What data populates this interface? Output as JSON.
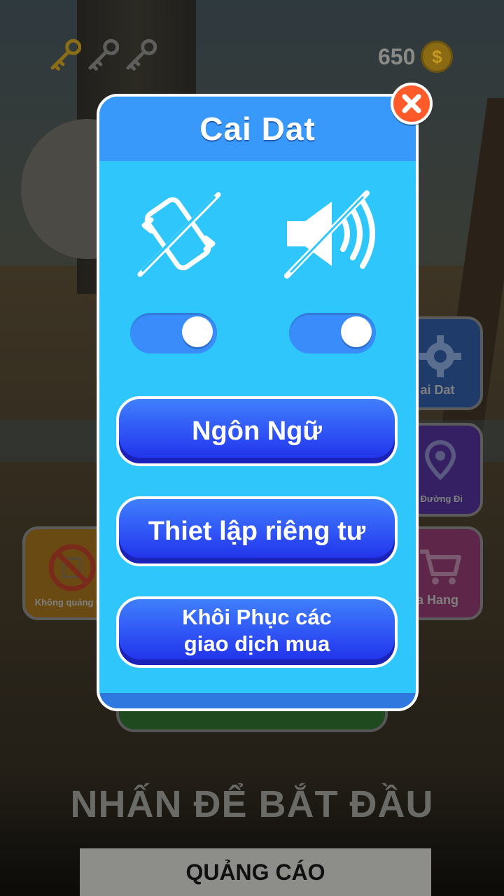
{
  "hud": {
    "keys": {
      "total": 3,
      "collected": 1,
      "icon": "key-icon"
    },
    "coins": {
      "value": "650",
      "icon": "coin-icon",
      "symbol": "$"
    }
  },
  "background_menu": {
    "settings_label": "ai Dat",
    "map_label": "ồ Đường Đi",
    "shop_label": "a Hang",
    "no_ads_label": "Không quảng c",
    "tap_to_start": "NHẤN ĐỂ BẮT ĐẦU",
    "ads_label": "QUẢNG CÁO"
  },
  "dialog": {
    "title": "Cai Dat",
    "close_icon": "close-icon",
    "vibration": {
      "icon": "vibration-off-icon",
      "enabled": true
    },
    "sound": {
      "icon": "sound-off-icon",
      "enabled": true
    },
    "buttons": {
      "language": "Ngôn Ngữ",
      "privacy": "Thiet lập riêng tư",
      "restore": "Khôi Phục các\ngiao dịch mua"
    }
  },
  "colors": {
    "dialog_body": "#2fc7fb",
    "dialog_header": "#3899fb",
    "button_blue": "#2f52f5",
    "toggle_track": "#3a8cfa",
    "close_red": "#ff5a2a"
  }
}
